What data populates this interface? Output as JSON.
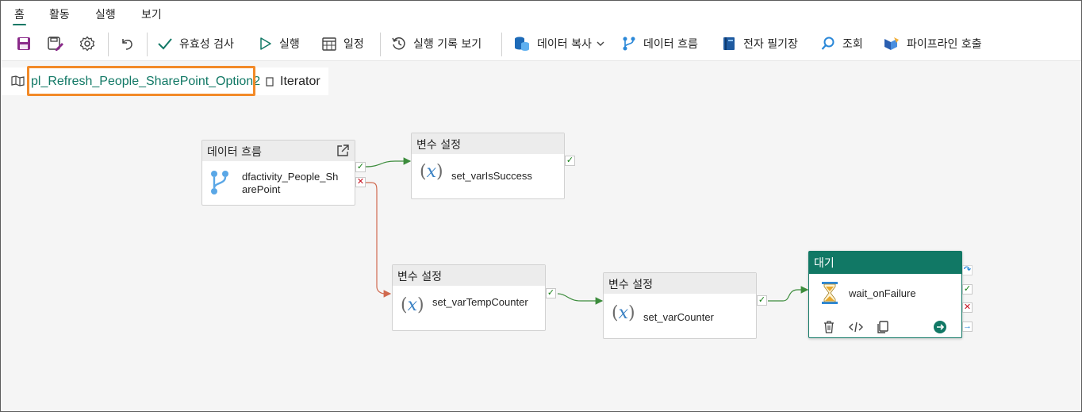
{
  "tabs": [
    {
      "label": "홈",
      "active": true
    },
    {
      "label": "활동",
      "active": false
    },
    {
      "label": "실행",
      "active": false
    },
    {
      "label": "보기",
      "active": false
    }
  ],
  "toolbar": {
    "save_icon": "save-icon",
    "save_as_template_icon": "save-as-template-icon",
    "settings_icon": "gear-icon",
    "undo_icon": "undo-icon",
    "validate": "유효성 검사",
    "run": "실행",
    "schedule": "일정",
    "view_run_history": "실행 기록 보기",
    "copy_data": "데이터 복사",
    "dataflow": "데이터 흐름",
    "notebook": "전자 필기장",
    "lookup": "조회",
    "invoke_pipeline": "파이프라인 호출"
  },
  "breadcrumb": {
    "pipeline": "pl_Refresh_People_SharePoint_Option2",
    "separator": "›",
    "current": "Iterator"
  },
  "nodes": {
    "dataflow": {
      "type": "데이터 흐름",
      "name": "dfactivity_People_SharePoint"
    },
    "set_success": {
      "type": "변수 설정",
      "name": "set_varIsSuccess"
    },
    "set_temp": {
      "type": "변수 설정",
      "name": "set_varTempCounter"
    },
    "set_counter": {
      "type": "변수 설정",
      "name": "set_varCounter"
    },
    "wait": {
      "type": "대기",
      "name": "wait_onFailure"
    }
  },
  "colors": {
    "accent": "#117865",
    "highlight": "#f28a28",
    "success": "#107c10",
    "failure": "#c50f1f"
  }
}
